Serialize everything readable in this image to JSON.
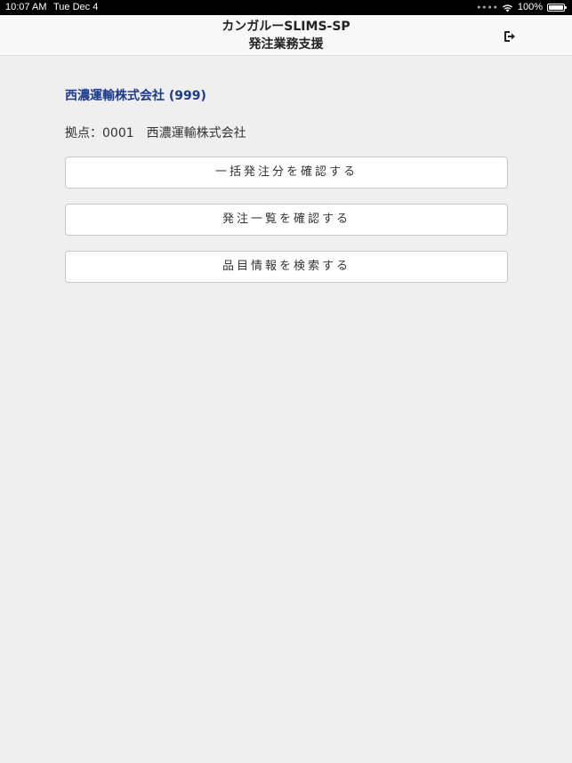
{
  "status_bar": {
    "time": "10:07 AM",
    "date": "Tue Dec 4",
    "battery": "100%",
    "signal_icon": "signal-dots-icon",
    "wifi_icon": "wifi-icon",
    "battery_icon": "battery-icon"
  },
  "header": {
    "title_line1": "カンガルーSLIMS-SP",
    "title_line2": "発注業務支援",
    "logout_icon": "logout-icon"
  },
  "main": {
    "company": "西濃運輸株式会社 (999)",
    "base_label": "拠点：0001",
    "base_name": "西濃運輸株式会社",
    "buttons": [
      {
        "label": "一括発注分を確認する"
      },
      {
        "label": "発注一覧を確認する"
      },
      {
        "label": "品目情報を検索する"
      }
    ]
  },
  "colors": {
    "company_text": "#1a3a8f",
    "background": "#efefef",
    "nav_background": "#f8f8f8"
  }
}
